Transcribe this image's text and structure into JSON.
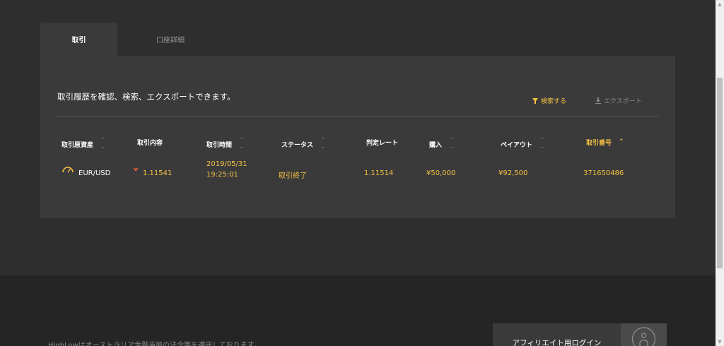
{
  "tabs": [
    {
      "label": "取引"
    },
    {
      "label": "口座詳細"
    }
  ],
  "panel": {
    "description": "取引履歴を確認、検索、エクスポートできます。",
    "search_label": "検索する",
    "export_label": "エクスポート"
  },
  "table": {
    "columns": [
      {
        "label": "取引原資産"
      },
      {
        "label": "取引内容"
      },
      {
        "label": "取引時間"
      },
      {
        "label": "ステータス"
      },
      {
        "label": "判定レート"
      },
      {
        "label": "購入"
      },
      {
        "label": "ペイアウト"
      },
      {
        "label": "取引番号"
      }
    ],
    "rows": [
      {
        "asset": "EUR/USD",
        "content": "1.11541",
        "date": "2019/05/31",
        "time": "19:25:01",
        "status": "取引終了",
        "rate": "1.11514",
        "purchase": "¥50,000",
        "payout": "¥92,500",
        "trade_id": "371650486"
      }
    ]
  },
  "footer": {
    "text": "HighLowはオーストラリア金融当局の法令等を遵守しております。",
    "affiliate_label": "アフィリエイト用ログイン"
  },
  "colors": {
    "accent": "#f5c242",
    "down_arrow": "#e8603c"
  },
  "icons": {
    "search": "filter-icon",
    "export": "download-icon",
    "asset": "gauge-icon",
    "direction": "arrow-down-icon",
    "sort": "sort-icon",
    "affiliate": "user-icon"
  }
}
